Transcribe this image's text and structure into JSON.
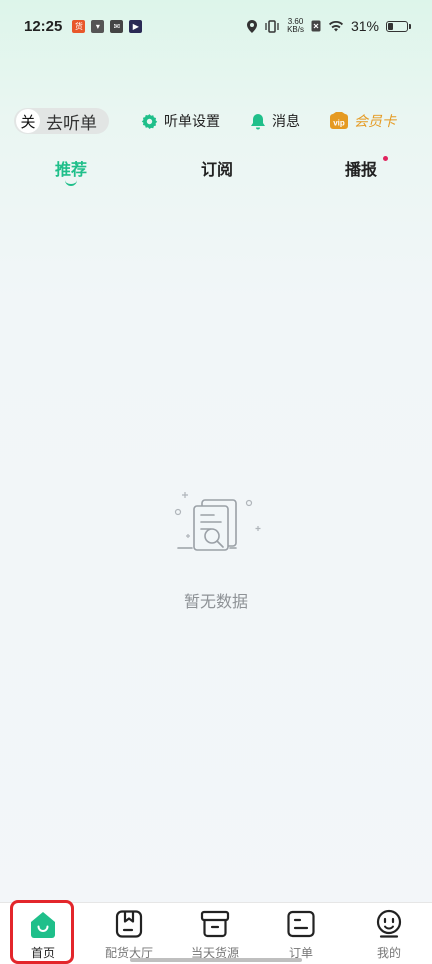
{
  "status_bar": {
    "time": "12:25",
    "network_speed_value": "3.60",
    "network_speed_unit": "KB/s",
    "battery": "31%",
    "battery_level": 0.31
  },
  "header": {
    "toggle_knob": "关",
    "toggle_label": "去听单",
    "order_settings": "听单设置",
    "messages": "消息",
    "vip_badge": "vip",
    "vip_card": "会员卡"
  },
  "tabs": [
    {
      "label": "推荐",
      "active": true
    },
    {
      "label": "订阅",
      "active": false
    },
    {
      "label": "播报",
      "active": false,
      "has_dot": true
    }
  ],
  "empty_state": {
    "text": "暂无数据"
  },
  "bottom_nav": [
    {
      "label": "首页",
      "icon": "home-icon",
      "active": true
    },
    {
      "label": "配货大厅",
      "icon": "bookmark-icon",
      "active": false
    },
    {
      "label": "当天货源",
      "icon": "box-icon",
      "active": false
    },
    {
      "label": "订单",
      "icon": "order-icon",
      "active": false
    },
    {
      "label": "我的",
      "icon": "profile-icon",
      "active": false
    }
  ],
  "colors": {
    "accent": "#1fbf8a",
    "vip": "#e59a22",
    "highlight": "#e3262b",
    "badge_dot": "#e0245e"
  }
}
